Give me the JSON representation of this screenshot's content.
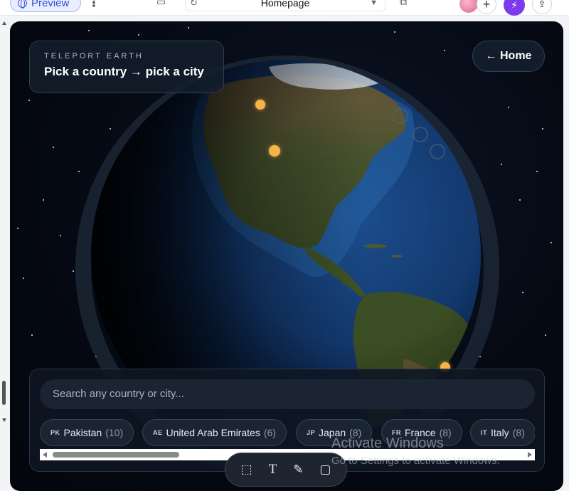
{
  "topbar": {
    "preview_label": "Preview",
    "page_name": "Homepage"
  },
  "app": {
    "eyebrow": "TELEPORT EARTH",
    "headline": "Pick a country → pick a city",
    "home_button": "← Home"
  },
  "search": {
    "placeholder": "Search any country or city..."
  },
  "countries": [
    {
      "code": "PK",
      "name": "Pakistan",
      "count": "(10)"
    },
    {
      "code": "AE",
      "name": "United Arab Emirates",
      "count": "(6)"
    },
    {
      "code": "JP",
      "name": "Japan",
      "count": "(8)"
    },
    {
      "code": "FR",
      "name": "France",
      "count": "(8)"
    },
    {
      "code": "IT",
      "name": "Italy",
      "count": "(8)"
    }
  ],
  "toolbar": {
    "tools": [
      "select-tool",
      "text-tool",
      "draw-tool",
      "comment-tool"
    ]
  },
  "watermark": {
    "line1": "Activate Windows",
    "line2": "Go to Settings to activate Windows."
  },
  "colors": {
    "accent": "#7c3aed",
    "marker": "#f7b24a",
    "panel": "#0e1622"
  }
}
